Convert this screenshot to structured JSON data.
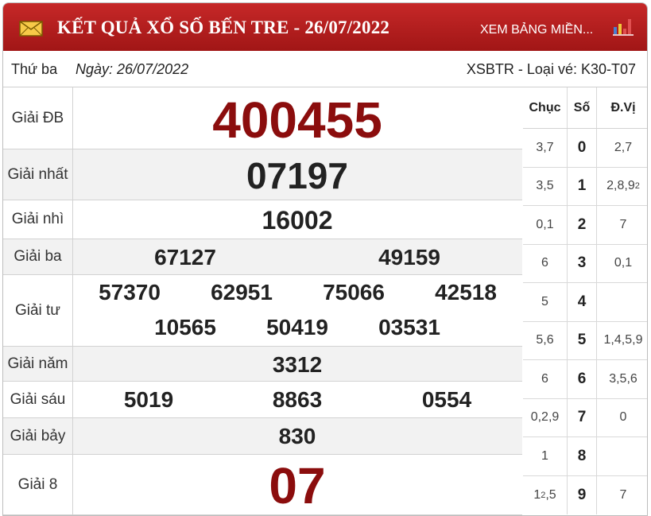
{
  "header": {
    "title": "KẾT QUẢ XỔ SỐ BẾN TRE - 26/07/2022",
    "link": "XEM BẢNG MIỀN...",
    "colors": {
      "bar": "#b71c1c",
      "number_red": "#8b0d0d"
    }
  },
  "info": {
    "day": "Thứ ba",
    "date": "Ngày: 26/07/2022",
    "ticket": "XSBTR - Loại vé: K30-T07"
  },
  "prizes": [
    {
      "label": "Giải ĐB",
      "numbers": [
        "400455"
      ]
    },
    {
      "label": "Giải nhất",
      "numbers": [
        "07197"
      ]
    },
    {
      "label": "Giải nhì",
      "numbers": [
        "16002"
      ]
    },
    {
      "label": "Giải ba",
      "numbers": [
        "67127",
        "49159"
      ]
    },
    {
      "label": "Giải tư",
      "numbers": [
        "57370",
        "62951",
        "75066",
        "42518",
        "10565",
        "50419",
        "03531"
      ]
    },
    {
      "label": "Giải năm",
      "numbers": [
        "3312"
      ]
    },
    {
      "label": "Giải sáu",
      "numbers": [
        "5019",
        "8863",
        "0554"
      ]
    },
    {
      "label": "Giải bảy",
      "numbers": [
        "830"
      ]
    },
    {
      "label": "Giải 8",
      "numbers": [
        "07"
      ]
    }
  ],
  "loto": {
    "headers": {
      "tens": "Chục",
      "digit": "Số",
      "units": "Đ.Vị"
    },
    "rows": [
      {
        "tens": "3,7",
        "digit": "0",
        "units": "2,7"
      },
      {
        "tens": "3,5",
        "digit": "1",
        "units": "2,8,9",
        "units_sup": "2"
      },
      {
        "tens": "0,1",
        "digit": "2",
        "units": "7"
      },
      {
        "tens": "6",
        "digit": "3",
        "units": "0,1"
      },
      {
        "tens": "5",
        "digit": "4",
        "units": ""
      },
      {
        "tens": "5,6",
        "digit": "5",
        "units": "1,4,5,9"
      },
      {
        "tens": "6",
        "digit": "6",
        "units": "3,5,6"
      },
      {
        "tens": "0,2,9",
        "digit": "7",
        "units": "0"
      },
      {
        "tens": "1",
        "digit": "8",
        "units": ""
      },
      {
        "tens": "1",
        "tens_sup": "2",
        "tens_after": ",5",
        "digit": "9",
        "units": "7"
      }
    ]
  }
}
